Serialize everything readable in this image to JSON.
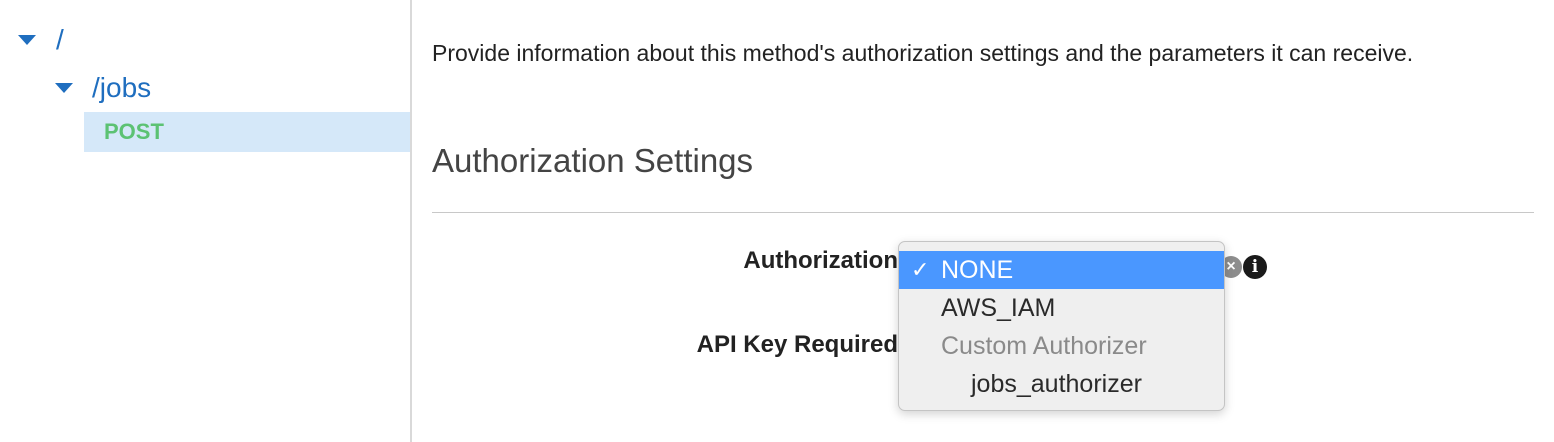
{
  "tree": {
    "root_label": "/",
    "jobs_label": "/jobs",
    "method_label": "POST"
  },
  "main": {
    "intro": "Provide information about this method's authorization settings and the parameters it can receive.",
    "section_title": "Authorization Settings",
    "authorization_label": "Authorization",
    "api_key_label": "API Key Required"
  },
  "authorization_dropdown": {
    "selected_value": "NONE",
    "check_mark": "✓",
    "options": [
      {
        "label": "NONE",
        "state": "selected"
      },
      {
        "label": "AWS_IAM",
        "state": "normal"
      },
      {
        "label": "Custom Authorizer",
        "state": "group-header"
      },
      {
        "label": "jobs_authorizer",
        "state": "normal"
      }
    ]
  },
  "icons": {
    "clear": "clear-icon",
    "info": "info-icon",
    "expand": "caret-down-icon"
  },
  "colors": {
    "link_blue": "#1f6ebf",
    "method_green": "#5cc273",
    "selected_row_bg": "#d5e8f9",
    "dropdown_highlight": "#4a97ff"
  }
}
